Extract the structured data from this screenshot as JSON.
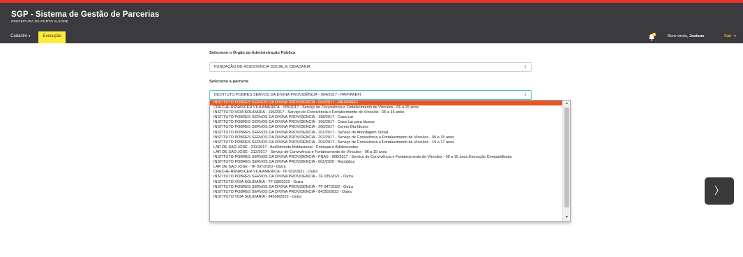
{
  "header": {
    "title": "SGP - Sistema de Gestão de Parcerias",
    "subtitle": "PREFEITURA DE PORTO ALEGRE"
  },
  "nav": {
    "cadastro": "Cadastro",
    "execucao": "Execução",
    "welcome_prefix": "Bem-vindo, ",
    "user": "Josiane",
    "logout": "Sair",
    "notification_count": "0"
  },
  "form": {
    "orgao_label": "Selecione o Órgão da Administração Pública",
    "orgao_value": "FUNDAÇÃO DE ASSISTENCIA SOCIAL E CIDADANIA",
    "parceria_label": "Selecione a parceria",
    "parceria_value": "INSTITUTO POBRES SERVOS DA DIVINA PROVIDÊNCIA - 004/2017 - PAIF/PAEFI",
    "options": [
      "INSTITUTO POBRES SERVOS DA DIVINA PROVIDÊNCIA - 004/2017 - PAIF/PAEFI",
      "CRECHE RENASCER VILA AMERICA - 165/2017 - Serviço de Convivência e Fortalecimento de Vínculos - 06 a 15 anos",
      "INSTITUTO VIDA SOLIDÁRIA - 196/2017 - Serviço de Convivência e Fortalecimento de Vínculos - 06 a 15 anos",
      "INSTITUTO POBRES SERVOS DA DIVINA PROVIDÊNCIA - 198/2017 - Casa Lar",
      "INSTITUTO POBRES SERVOS DA DIVINA PROVIDÊNCIA - 199/2017 - Casa Lar para Idosos",
      "INSTITUTO POBRES SERVOS DA DIVINA PROVIDÊNCIA - 200/2017 - Centro Dia Idosos",
      "INSTITUTO POBRES SERVOS DA DIVINA PROVIDÊNCIA - 201/2017 - Serviço de Abordagem Social",
      "INSTITUTO POBRES SERVOS DA DIVINA PROVIDÊNCIA - 202/2017 - Serviço de Convivência e Fortalecimento de Vínculos - 06 a 15 anos",
      "INSTITUTO POBRES SERVOS DA DIVINA PROVIDÊNCIA - 203/2017 - Serviço de Convivência e Fortalecimento de Vínculos - 15 a 17 anos",
      "LAR DE SÃO JOSÉ - 211/2017 - Acolhimento Institucional - Crianças e Adolescentes",
      "LAR DE SÃO JOSÉ - 212/2017 - Serviço de Convivência e Fortalecimento de Vínculos - 06 a 15 anos",
      "INSTITUTO POBRES SERVOS DA DIVINA PROVIDÊNCIA - FNAS - 008/2017 - Serviço de Convivência e Fortalecimento de Vínculos - 06 a 15 anos Execução Compartilhada",
      "INSTITUTO POBRES SERVOS DA DIVINA PROVIDÊNCIA - 002/2020 - República",
      "LAR DE SÃO JOSÉ - TF 037/2020 - Outra",
      "CRECHE RENASCER VILA AMERICA - TF 032/2021 - Outra",
      "INSTITUTO POBRES SERVOS DA DIVINA PROVIDÊNCIA - TF 035/2021 - Outra",
      "INSTITUTO VIDA SOLIDÁRIA - TF 038/2022 - Outra",
      "INSTITUTO POBRES SERVOS DA DIVINA PROVIDÊNCIA - TF 047/2022 - Outra",
      "INSTITUTO POBRES SERVOS DA DIVINA PROVIDÊNCIA - 84350/2023 - Outra",
      "INSTITUTO VIDA SOLIDÁRIA - 84509/2023 - Outra"
    ]
  },
  "colors": {
    "accent_red": "#e63329",
    "nav_active": "#ffeb3b",
    "selected_option": "#e8571f",
    "header_bg": "#3b3b3f"
  },
  "icons": {
    "bell": "bell-icon",
    "logout": "sign-out-icon",
    "next": "chevron-right-icon",
    "caret": "caret-down-icon"
  }
}
